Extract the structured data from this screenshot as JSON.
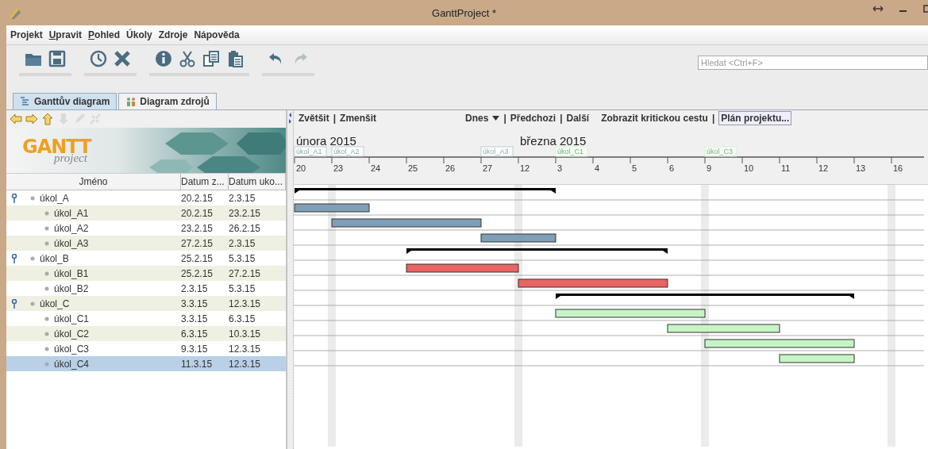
{
  "window": {
    "title": "GanttProject *"
  },
  "menu": [
    {
      "label": "Projekt",
      "mnemonic": false
    },
    {
      "label": "Upravit",
      "mnemonic": true
    },
    {
      "label": "Pohled",
      "mnemonic": true
    },
    {
      "label": "Úkoly",
      "mnemonic": false
    },
    {
      "label": "Zdroje",
      "mnemonic": false
    },
    {
      "label": "Nápověda",
      "mnemonic": false
    }
  ],
  "toolbar": {
    "groups": [
      [
        {
          "kind": "open",
          "disabled": false
        },
        {
          "kind": "save",
          "disabled": false
        }
      ],
      [
        {
          "kind": "clock",
          "disabled": false
        },
        {
          "kind": "delete",
          "disabled": false
        }
      ],
      [
        {
          "kind": "info",
          "disabled": false
        },
        {
          "kind": "cut",
          "disabled": false
        },
        {
          "kind": "copy",
          "disabled": false
        },
        {
          "kind": "paste",
          "disabled": false
        }
      ],
      [
        {
          "kind": "undo",
          "disabled": false
        },
        {
          "kind": "redo",
          "disabled": true
        }
      ]
    ],
    "search": {
      "placeholder": "Hledat <Ctrl+F>"
    }
  },
  "tabs": [
    {
      "label": "Ganttův diagram",
      "kind": "gantt",
      "selected": true
    },
    {
      "label": "Diagram zdrojů",
      "kind": "resources",
      "selected": false
    }
  ],
  "tree_toolbar": [
    {
      "kind": "left",
      "disabled": false
    },
    {
      "kind": "right",
      "disabled": false
    },
    {
      "kind": "up",
      "disabled": false
    },
    {
      "kind": "down",
      "disabled": true
    },
    {
      "kind": "edit",
      "disabled": true
    },
    {
      "kind": "unlink",
      "disabled": true
    }
  ],
  "logo": {
    "title": "GANTT",
    "subtitle": "project"
  },
  "table": {
    "columns": [
      "Jméno",
      "Datum z...",
      "Datum uko..."
    ],
    "rows": [
      {
        "name": "úkol_A",
        "start": "20.2.15",
        "end": "2.3.15",
        "kind": "summary",
        "expanded": true,
        "selected": false,
        "children": [
          {
            "name": "úkol_A1",
            "start": "20.2.15",
            "end": "23.2.15",
            "kind": "task",
            "selected": false,
            "color": "#7f9fb6",
            "chart_label": "úkol_A1",
            "chart_label_faint": false
          },
          {
            "name": "úkol_A2",
            "start": "23.2.15",
            "end": "26.2.15",
            "kind": "task",
            "selected": false,
            "color": "#7f9fb6",
            "chart_label": "úkol_A2",
            "chart_label_faint": false
          },
          {
            "name": "úkol_A3",
            "start": "27.2.15",
            "end": "2.3.15",
            "kind": "task",
            "selected": false,
            "color": "#7f9fb6",
            "chart_label": "úkol_A3",
            "chart_label_faint": false
          }
        ]
      },
      {
        "name": "úkol_B",
        "start": "25.2.15",
        "end": "5.3.15",
        "kind": "summary",
        "expanded": true,
        "selected": false,
        "children": [
          {
            "name": "úkol_B1",
            "start": "25.2.15",
            "end": "27.2.15",
            "kind": "task",
            "selected": false,
            "color": "#ea6464"
          },
          {
            "name": "úkol_B2",
            "start": "2.3.15",
            "end": "5.3.15",
            "kind": "task",
            "selected": false,
            "color": "#ea6464"
          }
        ]
      },
      {
        "name": "úkol_C",
        "start": "3.3.15",
        "end": "12.3.15",
        "kind": "summary",
        "expanded": true,
        "selected": false,
        "children": [
          {
            "name": "úkol_C1",
            "start": "3.3.15",
            "end": "6.3.15",
            "kind": "task",
            "selected": false,
            "color": "#c6f4c6",
            "chart_label": "úkol_C1",
            "chart_label_faint": true
          },
          {
            "name": "úkol_C2",
            "start": "6.3.15",
            "end": "10.3.15",
            "kind": "task",
            "selected": false,
            "color": "#c6f4c6"
          },
          {
            "name": "úkol_C3",
            "start": "9.3.15",
            "end": "12.3.15",
            "kind": "task",
            "selected": false,
            "color": "#c6f4c6",
            "chart_label": "úkol_C3",
            "chart_label_faint": true
          },
          {
            "name": "úkol_C4",
            "start": "11.3.15",
            "end": "12.3.15",
            "kind": "task",
            "selected": true,
            "color": "#c6f4c6"
          }
        ]
      }
    ]
  },
  "chart": {
    "links": [
      [
        {
          "label": "Zvětšit",
          "kind": "link"
        },
        {
          "label": "|",
          "kind": "separator"
        },
        {
          "label": "Zmenšit",
          "kind": "link"
        }
      ],
      [
        {
          "label": "Dnes",
          "kind": "dropdown"
        },
        {
          "label": "|",
          "kind": "separator"
        },
        {
          "label": "Předchozi",
          "kind": "link"
        },
        {
          "label": "|",
          "kind": "separator"
        },
        {
          "label": "Další",
          "kind": "link"
        }
      ],
      [
        {
          "label": "Zobrazit kritickou cestu",
          "kind": "link"
        },
        {
          "label": "|",
          "kind": "separator"
        },
        {
          "label": "Plán projektu...",
          "kind": "button"
        }
      ]
    ],
    "days": [
      {
        "label": "20",
        "month": "února 2015"
      },
      {
        "label": "23"
      },
      {
        "label": "24"
      },
      {
        "label": "25"
      },
      {
        "label": "26"
      },
      {
        "label": "27"
      },
      {
        "label": "12",
        "month": "března 2015"
      },
      {
        "label": "3"
      },
      {
        "label": "4"
      },
      {
        "label": "5"
      },
      {
        "label": "6"
      },
      {
        "label": "9"
      },
      {
        "label": "10"
      },
      {
        "label": "11"
      },
      {
        "label": "12"
      },
      {
        "label": "13"
      },
      {
        "label": "16"
      }
    ]
  }
}
